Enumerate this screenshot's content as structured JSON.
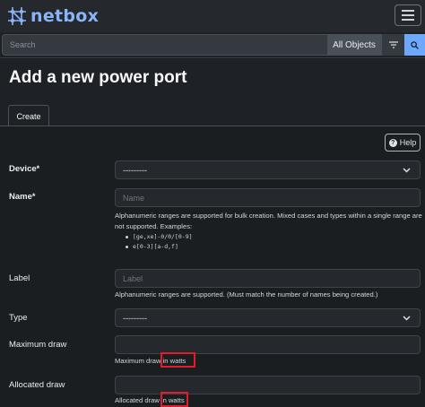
{
  "app": {
    "name": "netbox"
  },
  "search": {
    "placeholder": "Search",
    "scope_label": "All Objects"
  },
  "page": {
    "title": "Add a new power port",
    "tab_create": "Create",
    "help_label": "Help"
  },
  "form": {
    "device": {
      "label": "Device",
      "required_mark": "*",
      "value": "---------"
    },
    "name": {
      "label": "Name",
      "required_mark": "*",
      "placeholder": "Name",
      "hint_line1": "Alphanumeric ranges are supported for bulk creation. Mixed cases and types within a single range are",
      "hint_line2": "not supported. Examples:",
      "examples": [
        "[ge,xe]-0/0/[0-9]",
        "e[0-3][a-d,f]"
      ]
    },
    "label": {
      "label": "Label",
      "placeholder": "Label",
      "hint": "Alphanumeric ranges are supported. (Must match the number of names being created.)"
    },
    "type": {
      "label": "Type",
      "value": "---------"
    },
    "maximum_draw": {
      "label": "Maximum draw",
      "value": "",
      "hint_prefix": "Maximum draw ",
      "hint_suffix": "in watts"
    },
    "allocated_draw": {
      "label": "Allocated draw",
      "value": "",
      "hint_prefix": "Allocated draw ",
      "hint_suffix": "in watts"
    }
  },
  "colors": {
    "accent": "#6ea8fe",
    "logo": "#8ab4f8",
    "highlight": "#e11d2b"
  },
  "icons": {
    "logo": "netbox-logo-icon",
    "menu": "hamburger-icon",
    "filter": "filter-icon",
    "search": "search-icon",
    "help": "question-circle-icon",
    "dropdown": "chevron-down-icon"
  }
}
